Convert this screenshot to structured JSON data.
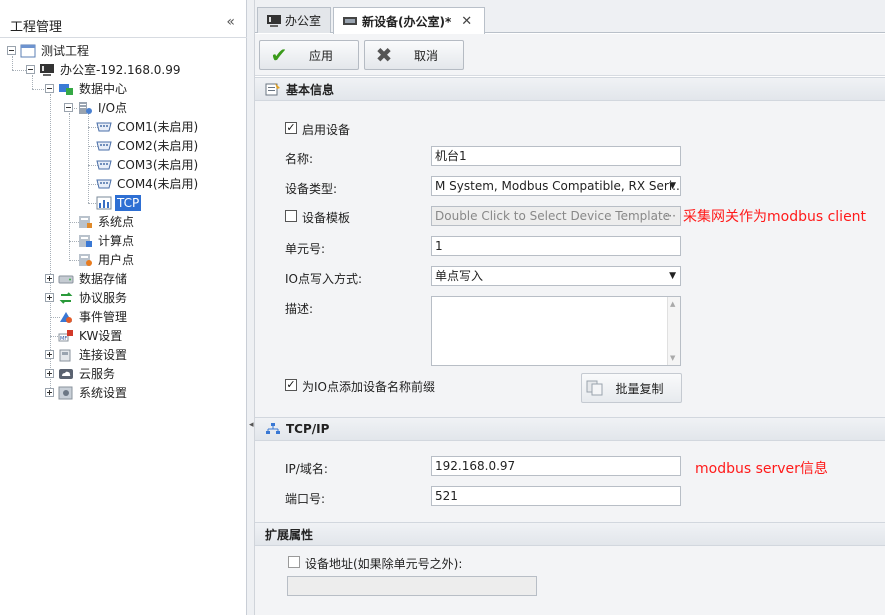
{
  "left_panel": {
    "title": "工程管理",
    "collapse_glyph": "«",
    "tree": [
      {
        "label": "测试工程",
        "icon": "project-icon"
      },
      {
        "label": "办公室-192.168.0.99",
        "icon": "device-monitor-icon"
      },
      {
        "label": "数据中心",
        "icon": "data-center-icon"
      },
      {
        "label": "I/O点",
        "icon": "io-points-icon"
      },
      {
        "label": "COM1(未启用)",
        "icon": "serial-port-icon"
      },
      {
        "label": "COM2(未启用)",
        "icon": "serial-port-icon"
      },
      {
        "label": "COM3(未启用)",
        "icon": "serial-port-icon"
      },
      {
        "label": "COM4(未启用)",
        "icon": "serial-port-icon"
      },
      {
        "label": "TCP",
        "icon": "tcp-chart-icon"
      },
      {
        "label": "系统点",
        "icon": "system-points-icon"
      },
      {
        "label": "计算点",
        "icon": "calc-points-icon"
      },
      {
        "label": "用户点",
        "icon": "user-points-icon"
      },
      {
        "label": "数据存储",
        "icon": "storage-icon"
      },
      {
        "label": "协议服务",
        "icon": "protocol-icon"
      },
      {
        "label": "事件管理",
        "icon": "event-icon"
      },
      {
        "label": "KW设置",
        "icon": "kw-settings-icon"
      },
      {
        "label": "连接设置",
        "icon": "connection-icon"
      },
      {
        "label": "云服务",
        "icon": "cloud-icon"
      },
      {
        "label": "系统设置",
        "icon": "system-settings-icon"
      }
    ]
  },
  "tabs": [
    {
      "label": "办公室",
      "icon": "device-monitor-icon"
    },
    {
      "label": "新设备(办公室)*",
      "icon": "device-tab-icon",
      "close": "✕"
    }
  ],
  "toolbar": {
    "apply_label": "应用",
    "cancel_label": "取消"
  },
  "basic_info": {
    "title": "基本信息",
    "enable_device_label": "启用设备",
    "enable_device_checked": true,
    "name_label": "名称:",
    "name_value": "机台1",
    "device_type_label": "设备类型:",
    "device_type_value": "M System, Modbus Compatible, RX Seri...",
    "template_label": "设备模板",
    "template_checked": false,
    "template_placeholder": "Double Click to Select Device Template",
    "template_more": "···",
    "unit_label": "单元号:",
    "unit_value": "1",
    "io_write_label": "IO点写入方式:",
    "io_write_value": "单点写入",
    "desc_label": "描述:",
    "desc_value": "",
    "prefix_label": "为IO点添加设备名称前缀",
    "prefix_checked": true,
    "batch_copy_label": "批量复制"
  },
  "tcpip": {
    "title": "TCP/IP",
    "ip_label": "IP/域名:",
    "ip_value": "192.168.0.97",
    "port_label": "端口号:",
    "port_value": "521"
  },
  "ext": {
    "title": "扩展属性",
    "device_addr_label": "设备地址(如果除单元号之外):",
    "device_addr_checked": false,
    "device_addr_value": ""
  },
  "annotations": {
    "client_note": "采集网关作为modbus client",
    "server_note": "modbus server信息"
  },
  "colors": {
    "selection": "#2e6fd3",
    "annotation": "#ff1a1a",
    "apply_check": "#3a9a1a"
  }
}
